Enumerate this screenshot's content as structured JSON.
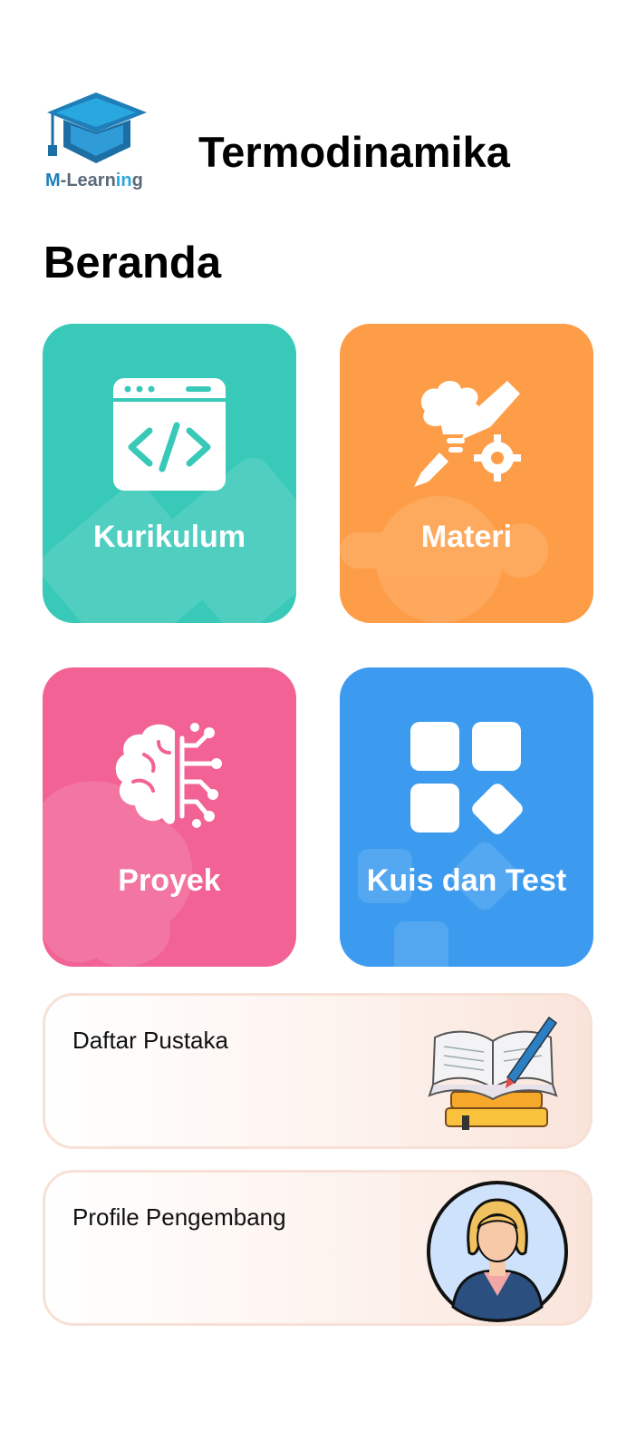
{
  "header": {
    "logo_text_m": "M",
    "logo_text_dash": "-Learn",
    "logo_text_in": "in",
    "logo_text_g": "g",
    "logo_icon": "graduation-cap-icon",
    "title": "Termodinamika"
  },
  "section_title": "Beranda",
  "tiles": [
    {
      "label": "Kurikulum",
      "color": "#38c9b9",
      "icon": "code-window-icon"
    },
    {
      "label": "Materi",
      "color": "#fd9d47",
      "icon": "creative-brain-pencil-icon"
    },
    {
      "label": "Proyek",
      "color": "#f26294",
      "icon": "brain-circuit-icon"
    },
    {
      "label": "Kuis dan Test",
      "color": "#3c9bef",
      "icon": "grid-shapes-icon"
    }
  ],
  "cards": [
    {
      "label": "Daftar Pustaka",
      "icon": "open-book-icon"
    },
    {
      "label": "Profile Pengembang",
      "icon": "developer-avatar-icon"
    }
  ]
}
